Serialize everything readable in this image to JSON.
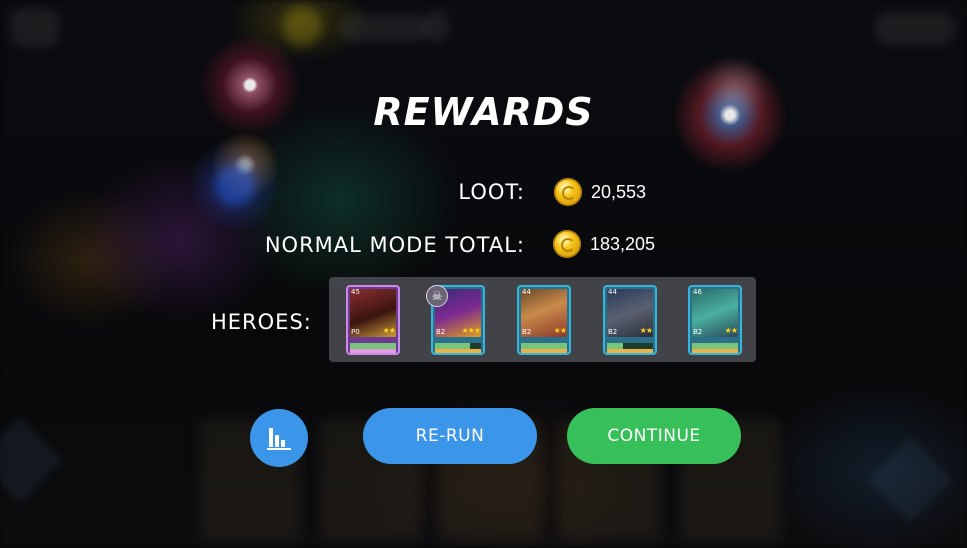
{
  "screen": {
    "title": "REWARDS"
  },
  "rewards": {
    "loot_label": "LOOT:",
    "loot_value": "20,553",
    "loot_icon": "gold-coin-icon",
    "total_label": "NORMAL MODE TOTAL:",
    "total_value": "183,205",
    "total_icon": "gold-coin-icon",
    "heroes_label": "HEROES:"
  },
  "heroes": [
    {
      "level": "45",
      "rank": "P0",
      "stars": "★★",
      "xp_fill": 1.0,
      "rarity": "epic"
    },
    {
      "level": "",
      "rank": "B2",
      "stars": "★★★",
      "xp_fill": 0.75,
      "rarity": "rare",
      "badge": "skull-icon"
    },
    {
      "level": "44",
      "rank": "B2",
      "stars": "★★",
      "xp_fill": 1.0,
      "rarity": "rare"
    },
    {
      "level": "44",
      "rank": "B2",
      "stars": "★★",
      "xp_fill": 0.35,
      "rarity": "rare"
    },
    {
      "level": "46",
      "rank": "B2",
      "stars": "★★",
      "xp_fill": 1.0,
      "rarity": "rare"
    }
  ],
  "buttons": {
    "stats_icon": "bar-chart-icon",
    "rerun_label": "RE-RUN",
    "continue_label": "CONTINUE"
  },
  "colors": {
    "rerun": "#3b95e8",
    "continue": "#37c05a",
    "coin": "#f5c419"
  }
}
